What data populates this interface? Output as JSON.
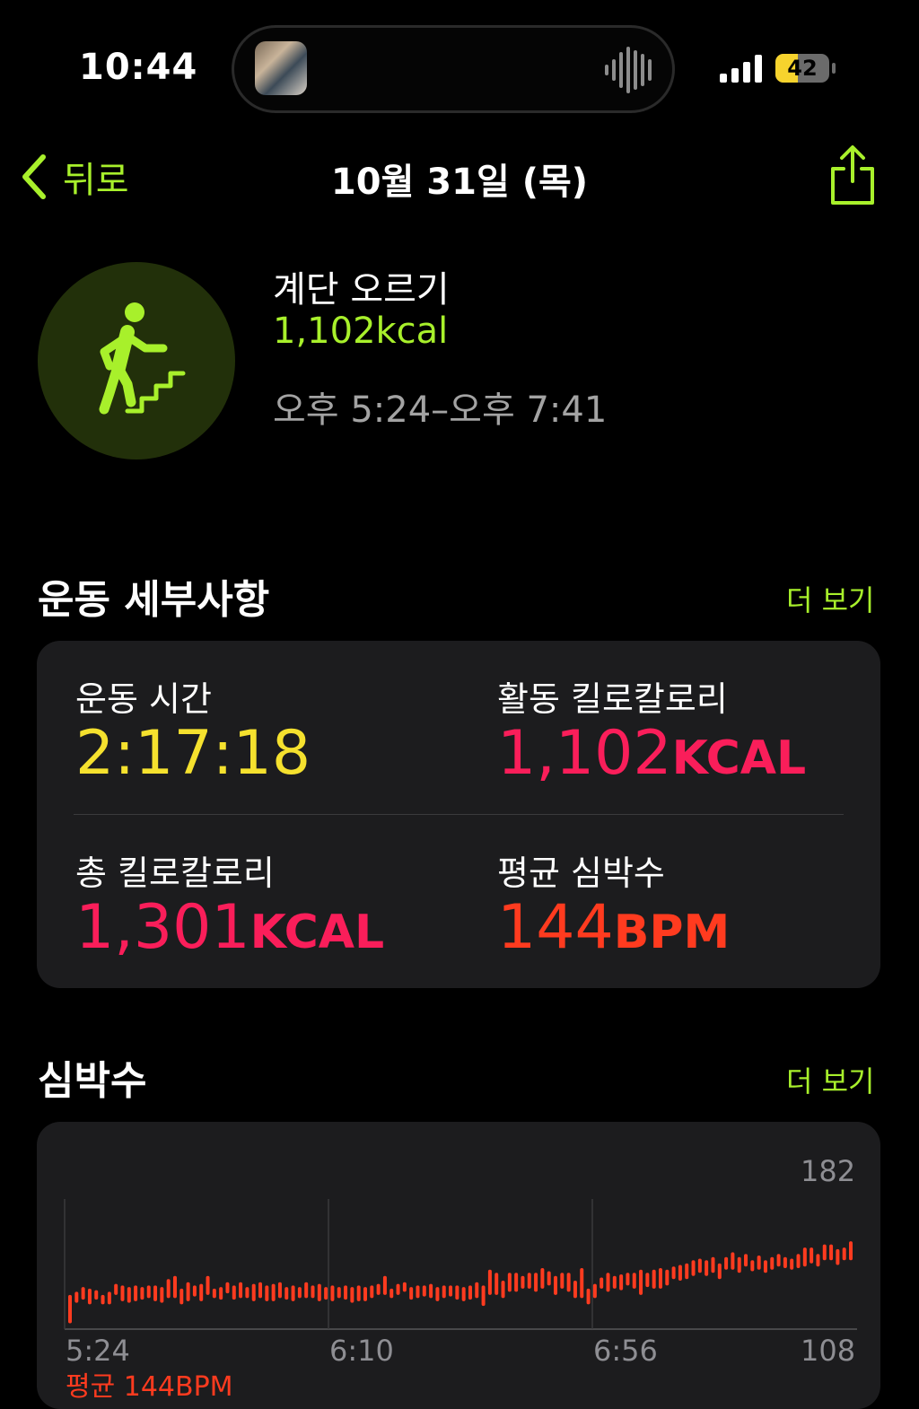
{
  "status_bar": {
    "time": "10:44",
    "battery": "42"
  },
  "nav": {
    "back_label": "뒤로",
    "title": "10월 31일 (목)"
  },
  "workout": {
    "name": "계단 오르기",
    "calories": "1,102kcal",
    "time_range": "오후 5:24–오후 7:41"
  },
  "details": {
    "section_title": "운동 세부사항",
    "more_label": "더 보기",
    "metrics": [
      {
        "label": "운동 시간",
        "value": "2:17:18",
        "unit": "",
        "color": "#f5e12e"
      },
      {
        "label": "활동 킬로칼로리",
        "value": "1,102",
        "unit": "KCAL",
        "color": "#fa1e5a"
      },
      {
        "label": "총 킬로칼로리",
        "value": "1,301",
        "unit": "KCAL",
        "color": "#fa1e5a"
      },
      {
        "label": "평균 심박수",
        "value": "144",
        "unit": "BPM",
        "color": "#ff3b1f"
      }
    ]
  },
  "heart_rate": {
    "section_title": "심박수",
    "more_label": "더 보기",
    "footer": "평균 144BPM"
  },
  "chart_data": {
    "type": "bar",
    "color": "#ff3b1f",
    "x_ticks": [
      "5:24",
      "6:10",
      "6:56"
    ],
    "y_ticks": [
      "182",
      "108"
    ],
    "ylim": [
      108,
      182
    ],
    "series": [
      {
        "ranges": [
          [
            110,
            128
          ],
          [
            123,
            130
          ],
          [
            125,
            133
          ],
          [
            122,
            132
          ],
          [
            125,
            131
          ],
          [
            122,
            128
          ],
          [
            122,
            130
          ],
          [
            128,
            135
          ],
          [
            124,
            134
          ],
          [
            123,
            133
          ],
          [
            124,
            134
          ],
          [
            125,
            133
          ],
          [
            126,
            134
          ],
          [
            124,
            134
          ],
          [
            123,
            133
          ],
          [
            126,
            138
          ],
          [
            126,
            140
          ],
          [
            122,
            132
          ],
          [
            124,
            136
          ],
          [
            127,
            134
          ],
          [
            124,
            135
          ],
          [
            128,
            140
          ],
          [
            126,
            132
          ],
          [
            125,
            133
          ],
          [
            129,
            136
          ],
          [
            125,
            134
          ],
          [
            126,
            136
          ],
          [
            126,
            133
          ],
          [
            124,
            135
          ],
          [
            126,
            136
          ],
          [
            124,
            134
          ],
          [
            124,
            135
          ],
          [
            126,
            136
          ],
          [
            125,
            133
          ],
          [
            124,
            134
          ],
          [
            126,
            133
          ],
          [
            126,
            136
          ],
          [
            126,
            134
          ],
          [
            124,
            135
          ],
          [
            125,
            133
          ],
          [
            124,
            134
          ],
          [
            126,
            133
          ],
          [
            125,
            134
          ],
          [
            123,
            133
          ],
          [
            124,
            134
          ],
          [
            124,
            133
          ],
          [
            126,
            134
          ],
          [
            128,
            135
          ],
          [
            128,
            140
          ],
          [
            126,
            132
          ],
          [
            128,
            135
          ],
          [
            130,
            136
          ],
          [
            125,
            133
          ],
          [
            126,
            134
          ],
          [
            127,
            134
          ],
          [
            126,
            135
          ],
          [
            124,
            133
          ],
          [
            126,
            134
          ],
          [
            127,
            134
          ],
          [
            125,
            134
          ],
          [
            124,
            133
          ],
          [
            125,
            134
          ],
          [
            126,
            136
          ],
          [
            121,
            134
          ],
          [
            128,
            144
          ],
          [
            128,
            142
          ],
          [
            126,
            137
          ],
          [
            130,
            142
          ],
          [
            130,
            142
          ],
          [
            132,
            140
          ],
          [
            132,
            142
          ],
          [
            130,
            142
          ],
          [
            132,
            145
          ],
          [
            134,
            143
          ],
          [
            128,
            140
          ],
          [
            132,
            142
          ],
          [
            130,
            142
          ],
          [
            126,
            137
          ],
          [
            126,
            145
          ],
          [
            122,
            132
          ],
          [
            126,
            135
          ],
          [
            132,
            139
          ],
          [
            130,
            142
          ],
          [
            132,
            140
          ],
          [
            131,
            141
          ],
          [
            134,
            142
          ],
          [
            132,
            142
          ],
          [
            128,
            144
          ],
          [
            133,
            142
          ],
          [
            132,
            144
          ],
          [
            132,
            145
          ],
          [
            134,
            144
          ],
          [
            138,
            146
          ],
          [
            137,
            147
          ],
          [
            138,
            148
          ],
          [
            140,
            150
          ],
          [
            142,
            151
          ],
          [
            140,
            150
          ],
          [
            142,
            152
          ],
          [
            138,
            148
          ],
          [
            144,
            152
          ],
          [
            144,
            155
          ],
          [
            142,
            152
          ],
          [
            146,
            154
          ],
          [
            143,
            150
          ],
          [
            144,
            153
          ],
          [
            142,
            150
          ],
          [
            144,
            152
          ],
          [
            146,
            154
          ],
          [
            145,
            152
          ],
          [
            144,
            151
          ],
          [
            145,
            154
          ],
          [
            146,
            158
          ],
          [
            148,
            158
          ],
          [
            146,
            154
          ],
          [
            150,
            160
          ],
          [
            150,
            160
          ],
          [
            147,
            157
          ],
          [
            150,
            158
          ],
          [
            150,
            162
          ]
        ]
      }
    ]
  }
}
